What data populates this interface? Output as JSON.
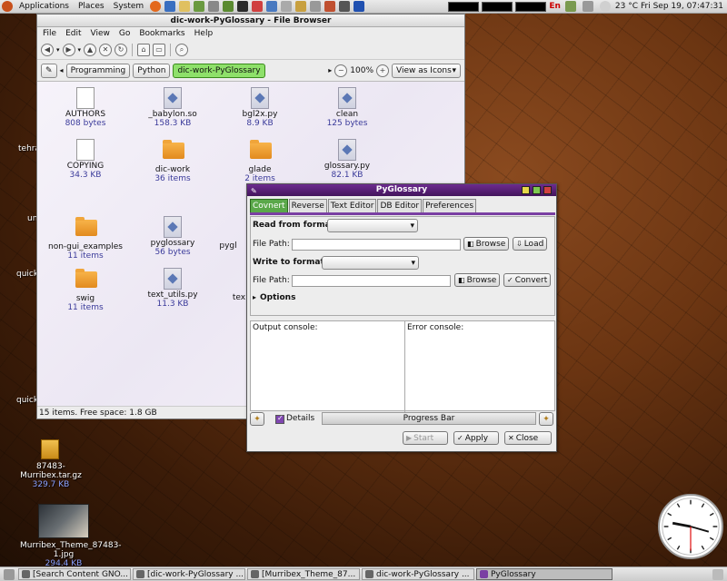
{
  "top_panel": {
    "menus": [
      "Applications",
      "Places",
      "System"
    ],
    "keyboard_layout": "En",
    "temperature": "23 °C",
    "clock": "Fri Sep 19, 07:47:31"
  },
  "desktop": {
    "partial_labels": [
      "tehra",
      "un",
      "quick",
      "quick"
    ],
    "icons": [
      {
        "name": "87483-Murribex.tar.gz",
        "size": "329.7 KB"
      },
      {
        "name": "Murribex_Theme_87483-1.jpg",
        "size": "294.4 KB"
      }
    ]
  },
  "file_browser": {
    "title": "dic-work-PyGlossary - File Browser",
    "menu": [
      "File",
      "Edit",
      "View",
      "Go",
      "Bookmarks",
      "Help"
    ],
    "path": [
      "Programming",
      "Python",
      "dic-work-PyGlossary"
    ],
    "zoom": "100%",
    "view_mode": "View as Icons",
    "files": [
      {
        "name": "AUTHORS",
        "size": "808 bytes",
        "kind": "text"
      },
      {
        "name": "_babylon.so",
        "size": "158.3 KB",
        "kind": "binary"
      },
      {
        "name": "bgl2x.py",
        "size": "8.9 KB",
        "kind": "python"
      },
      {
        "name": "clean",
        "size": "125 bytes",
        "kind": "python"
      },
      {
        "name": "COPYING",
        "size": "34.3 KB",
        "kind": "text"
      },
      {
        "name": "dic-work",
        "size": "36 items",
        "kind": "folder"
      },
      {
        "name": "glade",
        "size": "2 items",
        "kind": "folder"
      },
      {
        "name": "glossary.py",
        "size": "82.1 KB",
        "kind": "python"
      },
      {
        "name": "non-gui_examples",
        "size": "11 items",
        "kind": "folder"
      },
      {
        "name": "pyglossary",
        "size": "56 bytes",
        "kind": "python"
      },
      {
        "name": "pygl",
        "size": "",
        "kind": "python"
      },
      {
        "name": "swig",
        "size": "11 items",
        "kind": "folder"
      },
      {
        "name": "text_utils.py",
        "size": "11.3 KB",
        "kind": "python"
      },
      {
        "name": "tex",
        "size": "",
        "kind": "python"
      }
    ],
    "status": "15 items. Free space: 1.8 GB"
  },
  "pyglossary": {
    "title": "PyGlossary",
    "tabs": [
      "Covnert",
      "Reverse",
      "Text Editor",
      "DB Editor",
      "Preferences"
    ],
    "read_format_label": "Read from format:",
    "write_format_label": "Write to format:",
    "file_path_label": "File Path:",
    "browse_label": "Browse",
    "load_label": "Load",
    "convert_label": "Convert",
    "options_label": "Options",
    "output_console_label": "Output console:",
    "error_console_label": "Error console:",
    "details_label": "Details",
    "progress_label": "Progress Bar",
    "start_label": "Start",
    "apply_label": "Apply",
    "close_label": "Close"
  },
  "taskbar": [
    {
      "label": "[Search Content GNO...",
      "active": false
    },
    {
      "label": "[dic-work-PyGlossary ...",
      "active": false
    },
    {
      "label": "[Murribex_Theme_87...",
      "active": false
    },
    {
      "label": "dic-work-PyGlossary ...",
      "active": false
    },
    {
      "label": "PyGlossary",
      "active": true
    }
  ]
}
